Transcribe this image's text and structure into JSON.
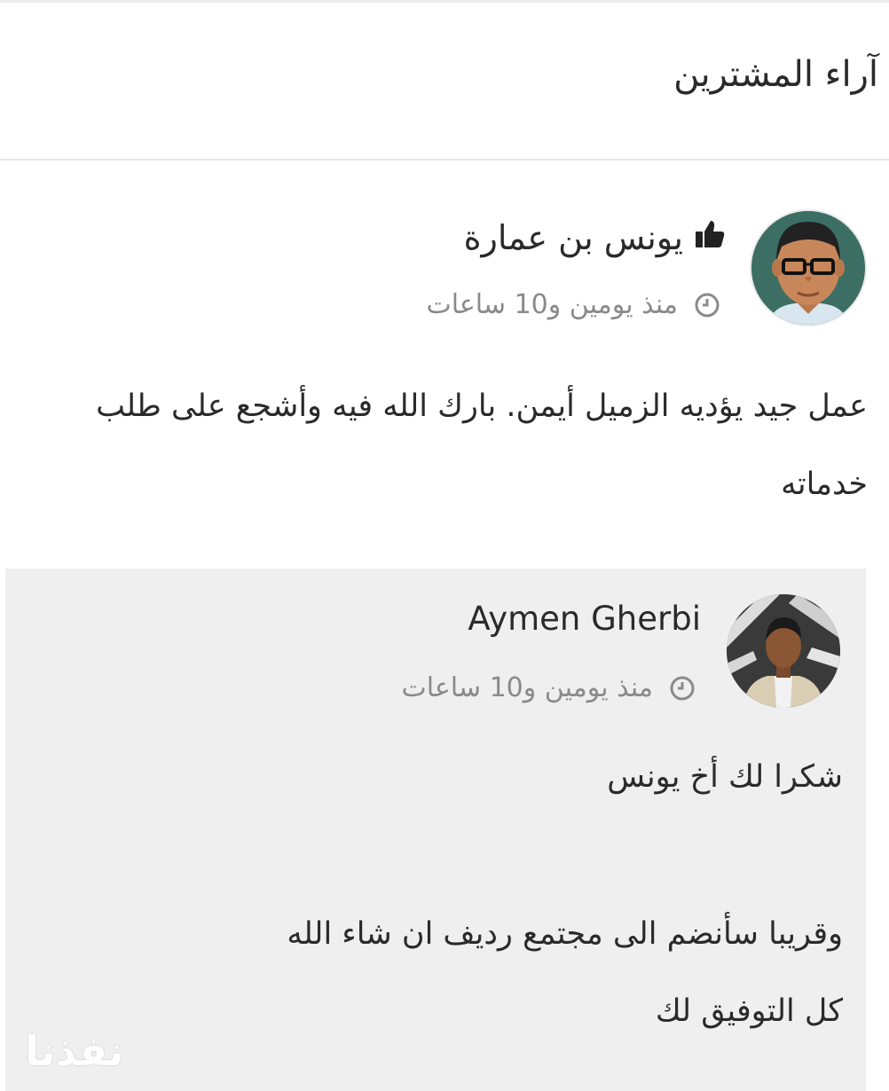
{
  "section": {
    "title": "آراء المشترين"
  },
  "review": {
    "reviewer_name": "يونس بن عمارة",
    "rating_icon": "thumbs-up-icon",
    "time_ago": "منذ يومين و10 ساعات",
    "text": "عمل جيد يؤديه الزميل أيمن. بارك الله فيه وأشجع على طلب خدماته"
  },
  "reply": {
    "author_name": "Aymen Gherbi",
    "time_ago": "منذ يومين و10 ساعات",
    "lines": [
      "شكرا لك أخ يونس",
      "وقريبا سأنضم الى مجتمع رديف ان شاء الله",
      "كل التوفيق لك"
    ]
  },
  "watermark": {
    "text": "نفذنا"
  },
  "colors": {
    "reply_background": "#efefef",
    "meta_text": "#8a8a8a",
    "avatar_bg": "#3c6e64"
  }
}
